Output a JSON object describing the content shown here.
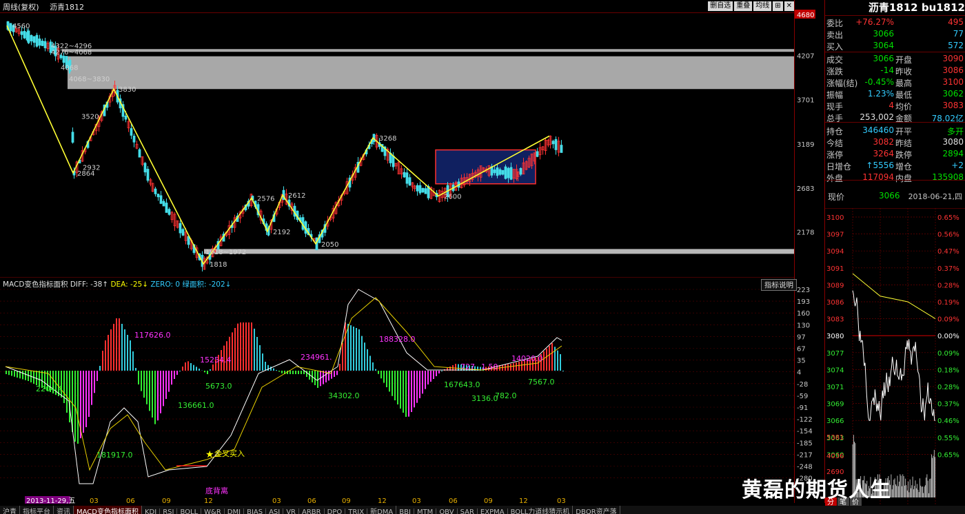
{
  "header": {
    "period_label": "周线(复权)",
    "symbol_label": "沥青1812",
    "buttons": [
      "删自选",
      "重叠",
      "均线",
      "⊞",
      "✕"
    ]
  },
  "main_chart": {
    "price_axis": [
      "4680",
      "4207",
      "3701",
      "3189",
      "2683",
      "2178"
    ],
    "point_labels": [
      "4560",
      "4322~4296",
      "4276~4068",
      "4068",
      "4068~3830",
      "3830",
      "3520",
      "2932",
      "2864",
      "3268",
      "2576",
      "2612",
      "2192",
      "2050",
      "2600",
      "1918~1972",
      "1818"
    ]
  },
  "macd": {
    "header": {
      "name": "MACD变色指标面积",
      "diff": "DIFF: -38↑",
      "dea": "DEA: -25↓",
      "zero": "ZERO: 0",
      "area": "绿面积: -202↓"
    },
    "ind_button": "指标说明",
    "axis": [
      "223",
      "193",
      "160",
      "130",
      "97",
      "67",
      "35",
      "4",
      "-28",
      "-59",
      "-91",
      "-122",
      "-154",
      "-185",
      "-217",
      "-248",
      "-280"
    ],
    "area_labels": {
      "magenta": [
        "117626.0",
        "15254.4",
        "234961.",
        "188328.0",
        "727",
        "1.50",
        "14020.0"
      ],
      "green": [
        "2204.4",
        "5673.0",
        "136661.0",
        "181917.0",
        "34302.0",
        "167643.0",
        "3136.0",
        "782.0",
        "7567.0"
      ]
    },
    "signal_label": "金叉买入",
    "divergence_label": "底背离"
  },
  "date_axis": {
    "highlight": "2013-11-29,五",
    "labels": [
      "03",
      "06",
      "09",
      "12",
      "03",
      "06",
      "09",
      "12",
      "03",
      "06",
      "09",
      "12",
      "03",
      "06"
    ]
  },
  "tabs": [
    "沪青",
    "指标平台",
    "资讯",
    "MACD变色指标面积",
    "KDJ",
    "RSI",
    "BOLL",
    "W&R",
    "DMI",
    "BIAS",
    "ASI",
    "VR",
    "ARBR",
    "DPO",
    "TRIX",
    "新DMA",
    "BBI",
    "MTM",
    "OBV",
    "SAR",
    "EXPMA",
    "BOLL力道线猜示机",
    "DBQR资产落"
  ],
  "quote": {
    "title": "沥青1812 bu1812",
    "rows": [
      {
        "l1": "委比",
        "v1": "+76.27%",
        "l2": "",
        "v2": "495",
        "c1": "red",
        "c2": "red"
      },
      {
        "l1": "卖出",
        "v1": "3066",
        "l2": "",
        "v2": "77",
        "c1": "grn",
        "c2": "cyn"
      },
      {
        "l1": "买入",
        "v1": "3064",
        "l2": "",
        "v2": "572",
        "c1": "grn",
        "c2": "cyn"
      },
      {
        "l1": "成交",
        "v1": "3066",
        "l2": "开盘",
        "v2": "3090",
        "c1": "grn",
        "c2": "red"
      },
      {
        "l1": "涨跌",
        "v1": "-14",
        "l2": "昨收",
        "v2": "3086",
        "c1": "grn",
        "c2": "red"
      },
      {
        "l1": "涨幅(结)",
        "v1": "-0.45%",
        "l2": "最高",
        "v2": "3100",
        "c1": "grn",
        "c2": "red"
      },
      {
        "l1": "振幅",
        "v1": "1.23%",
        "l2": "最低",
        "v2": "3062",
        "c1": "cyn",
        "c2": "grn"
      },
      {
        "l1": "现手",
        "v1": "4",
        "l2": "均价",
        "v2": "3083",
        "c1": "red",
        "c2": "red"
      },
      {
        "l1": "总手",
        "v1": "253,002",
        "l2": "金额",
        "v2": "78.02亿",
        "c1": "wht",
        "c2": "cyn"
      },
      {
        "l1": "持仓",
        "v1": "346460",
        "l2": "开平",
        "v2": "多开",
        "c1": "cyn",
        "c2": "grn"
      },
      {
        "l1": "今结",
        "v1": "3082",
        "l2": "昨结",
        "v2": "3080",
        "c1": "red",
        "c2": "wht"
      },
      {
        "l1": "涨停",
        "v1": "3264",
        "l2": "跌停",
        "v2": "2894",
        "c1": "red",
        "c2": "grn"
      },
      {
        "l1": "日增仓",
        "v1": "↑5556",
        "l2": "增仓",
        "v2": "+2",
        "c1": "cyn",
        "c2": "cyn"
      },
      {
        "l1": "外盘",
        "v1": "117094",
        "l2": "内盘",
        "v2": "135908",
        "c1": "red",
        "c2": "grn"
      }
    ],
    "now_label": "现价",
    "now_value": "3066",
    "date": "2018-06-21,四"
  },
  "intraday": {
    "prices": [
      "3100",
      "3097",
      "3094",
      "3091",
      "3089",
      "3086",
      "3083",
      "3080",
      "3077",
      "3074",
      "3071",
      "3069",
      "3066",
      "3063",
      "3060"
    ],
    "pcts": [
      "0.65%",
      "0.56%",
      "0.47%",
      "0.37%",
      "0.28%",
      "0.19%",
      "0.09%",
      "0.00%",
      "0.09%",
      "0.18%",
      "0.28%",
      "0.37%",
      "0.46%",
      "0.55%",
      "0.65%"
    ],
    "vol_axis": [
      "5381",
      "4036",
      "2690"
    ],
    "bottom_tabs": [
      "分",
      "笔",
      "价"
    ]
  },
  "watermark": "黄磊的期货人生",
  "colors": {
    "up": "#ff3333",
    "down": "#33ddee",
    "line": "#ffff33",
    "grid": "#8a0000",
    "magenta": "#ff33ff",
    "green": "#33ee33"
  }
}
